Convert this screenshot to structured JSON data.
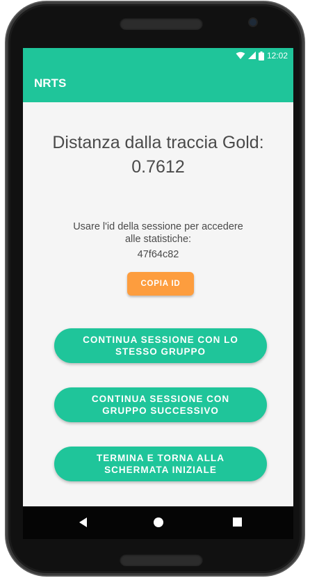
{
  "status_bar": {
    "time": "12:02",
    "wifi_icon": "wifi-icon",
    "signal_icon": "signal-icon",
    "battery_icon": "battery-icon"
  },
  "app_bar": {
    "title": "NRTS"
  },
  "result": {
    "label": "Distanza dalla traccia Gold:",
    "value": "0.7612"
  },
  "session": {
    "info_line1": "Usare l'id della sessione per accedere",
    "info_line2": "alle statistiche:",
    "id": "47f64c82",
    "copy_button": "COPIA ID"
  },
  "actions": {
    "continue_same_line1": "CONTINUA SESSIONE CON LO",
    "continue_same_line2": "STESSO GRUPPO",
    "continue_next_line1": "CONTINUA SESSIONE CON",
    "continue_next_line2": "GRUPPO SUCCESSIVO",
    "end_line1": "TERMINA E TORNA ALLA",
    "end_line2": "SCHERMATA INIZIALE"
  },
  "nav_bar": {
    "back_icon": "back-triangle-icon",
    "home_icon": "home-circle-icon",
    "recent_icon": "recent-square-icon"
  },
  "colors": {
    "primary": "#1fc59a",
    "accent": "#fd9d3e",
    "background": "#f5f5f5",
    "text": "#4a4a4a"
  }
}
